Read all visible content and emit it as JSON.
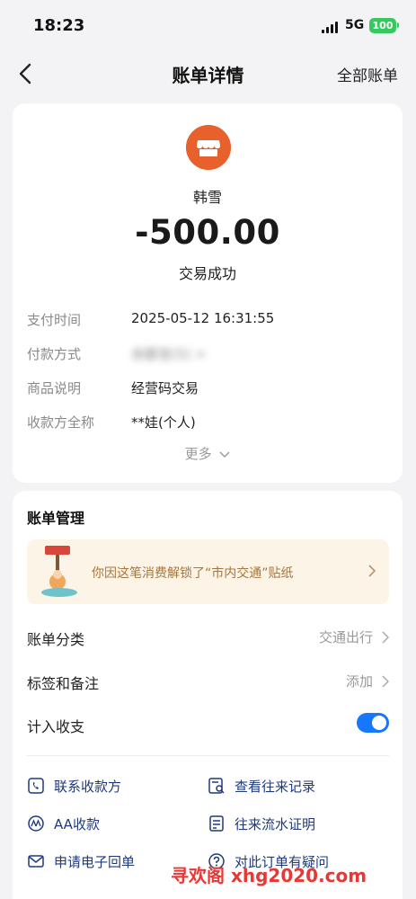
{
  "status_bar": {
    "time": "18:23",
    "network": "5G",
    "battery": "100"
  },
  "nav": {
    "title": "账单详情",
    "right_link": "全部账单"
  },
  "transaction": {
    "merchant_name": "韩雪",
    "amount": "-500.00",
    "status": "交易成功"
  },
  "details": [
    {
      "label": "支付时间",
      "value": "2025-05-12 16:31:55"
    },
    {
      "label": "付款方式",
      "value": "余额宝(5) >"
    },
    {
      "label": "商品说明",
      "value": "经营码交易"
    },
    {
      "label": "收款方全称",
      "value": "**娃(个人)"
    }
  ],
  "more": "更多",
  "management": {
    "title": "账单管理",
    "banner_text": "你因这笔消费解锁了“市内交通”贴纸",
    "category_label": "账单分类",
    "category_value": "交通出行",
    "tags_label": "标签和备注",
    "tags_value": "添加",
    "include_label": "计入收支",
    "include_enabled": true
  },
  "actions": [
    {
      "label": "联系收款方",
      "icon": "phone-icon"
    },
    {
      "label": "查看往来记录",
      "icon": "search-record-icon"
    },
    {
      "label": "AA收款",
      "icon": "aa-icon"
    },
    {
      "label": "往来流水证明",
      "icon": "document-icon"
    },
    {
      "label": "申请电子回单",
      "icon": "mail-icon"
    },
    {
      "label": "对此订单有疑问",
      "icon": "question-icon"
    }
  ],
  "watermark": "寻欢阁 xhg2020.com",
  "colors": {
    "accent": "#1677ff",
    "merchant": "#e8612c",
    "banner_text": "#a8763b",
    "action_text": "#1f3a7a"
  }
}
